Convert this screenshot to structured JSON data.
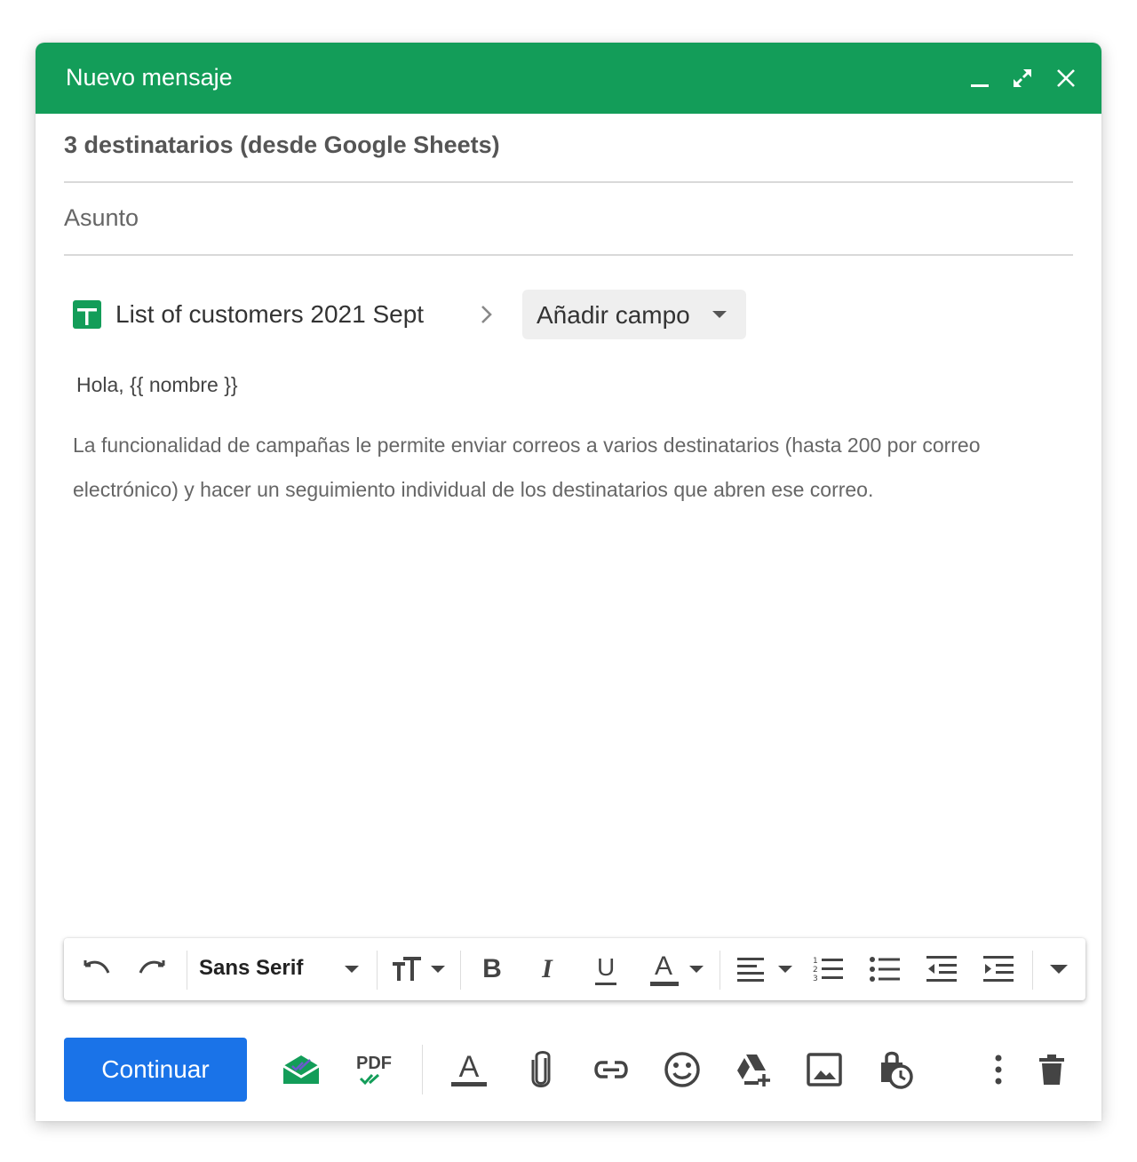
{
  "window": {
    "title": "Nuevo mensaje",
    "header_color": "#139d59"
  },
  "compose": {
    "recipients": "3 destinatarios (desde Google Sheets)",
    "subject_placeholder": "Asunto",
    "sheet_name": "List of customers 2021 Sept",
    "add_field_label": "Añadir campo",
    "greeting": "Hola, {{ nombre }}",
    "body": "La funcionalidad de campañas le permite enviar correos a varios destinatarios (hasta 200 por correo electrónico) y hacer un seguimiento individual de los destinatarios que abren ese correo."
  },
  "formatting": {
    "font_family_label": "Sans Serif",
    "bold_glyph": "B",
    "italic_glyph": "I",
    "underline_glyph": "U",
    "text_color_glyph": "A"
  },
  "actions": {
    "continue_label": "Continuar",
    "primary_color": "#1a73e8",
    "pdf_label": "PDF"
  },
  "icons": [
    "minimize-icon",
    "expand-icon",
    "close-icon",
    "sheets-icon",
    "chevron-right-icon",
    "undo-icon",
    "redo-icon",
    "text-size-icon",
    "align-icon",
    "numbered-list-icon",
    "bulleted-list-icon",
    "indent-less-icon",
    "indent-more-icon",
    "more-formatting-icon",
    "envelope-check-icon",
    "pdf-check-icon",
    "text-format-icon",
    "attach-icon",
    "link-icon",
    "emoji-icon",
    "drive-icon",
    "photo-icon",
    "confidential-icon",
    "more-options-icon",
    "delete-icon"
  ]
}
